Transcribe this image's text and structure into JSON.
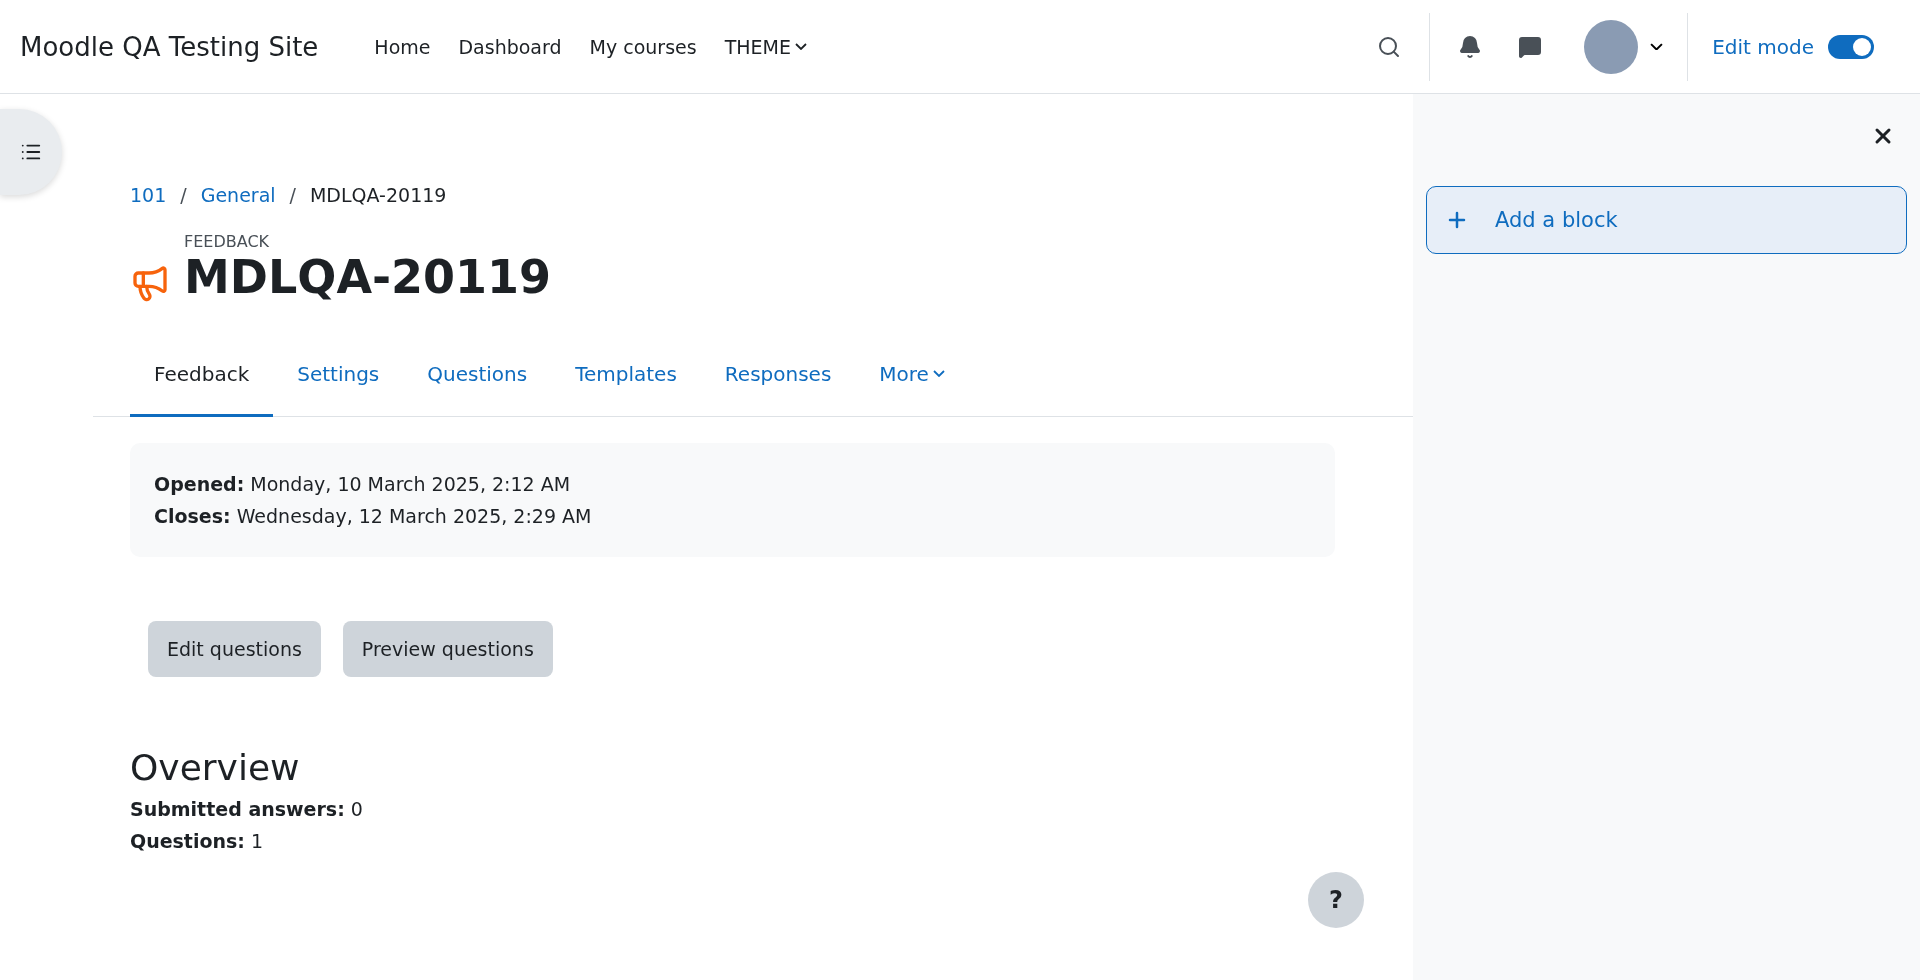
{
  "navbar": {
    "site_name": "Moodle QA Testing Site",
    "links": [
      {
        "label": "Home",
        "dropdown": false
      },
      {
        "label": "Dashboard",
        "dropdown": false
      },
      {
        "label": "My courses",
        "dropdown": false
      },
      {
        "label": "THEME",
        "dropdown": true
      }
    ],
    "edit_mode": {
      "label": "Edit mode",
      "on": true
    }
  },
  "breadcrumb_separator": "/",
  "breadcrumb": [
    {
      "label": "101",
      "link": true
    },
    {
      "label": "General",
      "link": true
    },
    {
      "label": "MDLQA-20119",
      "link": false
    }
  ],
  "header": {
    "module_type": "FEEDBACK",
    "title": "MDLQA-20119"
  },
  "tabs": [
    {
      "label": "Feedback",
      "selected": true,
      "dropdown": false
    },
    {
      "label": "Settings",
      "selected": false,
      "dropdown": false
    },
    {
      "label": "Questions",
      "selected": false,
      "dropdown": false
    },
    {
      "label": "Templates",
      "selected": false,
      "dropdown": false
    },
    {
      "label": "Responses",
      "selected": false,
      "dropdown": false
    },
    {
      "label": "More",
      "selected": false,
      "dropdown": true
    }
  ],
  "dates": [
    "**Opened:** Monday, 10 March 2025, 2:12 AM",
    "**Closes:** Wednesday, 12 March 2025, 2:29 AM"
  ],
  "buttons": [
    "Edit questions",
    "Preview questions"
  ],
  "overview": {
    "heading": "Overview",
    "lines": [
      "**Submitted answers:** 0",
      "**Questions:** 1"
    ]
  },
  "help_button": "?",
  "block_drawer": {
    "add_block": "Add a block"
  }
}
